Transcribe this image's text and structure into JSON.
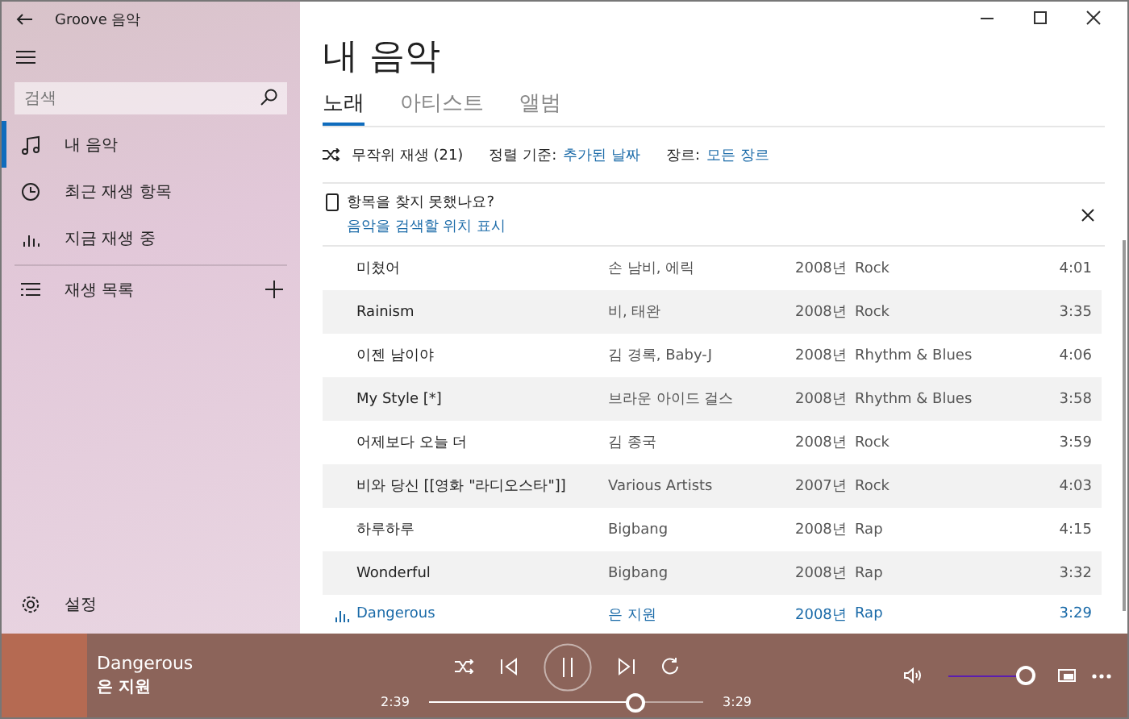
{
  "window": {
    "title": "Groove 음악"
  },
  "sidebar": {
    "search": {
      "placeholder": "검색"
    },
    "items": [
      {
        "label": "내 음악",
        "selected": true
      },
      {
        "label": "최근 재생 항목",
        "selected": false
      },
      {
        "label": "지금 재생 중",
        "selected": false
      }
    ],
    "playlists": {
      "label": "재생 목록"
    },
    "settings": {
      "label": "설정"
    }
  },
  "page": {
    "title": "내 음악",
    "tabs": [
      {
        "label": "노래",
        "selected": true
      },
      {
        "label": "아티스트",
        "selected": false
      },
      {
        "label": "앨범",
        "selected": false
      }
    ],
    "toolbar": {
      "shuffle": "무작위 재생 (21)",
      "sort_label": "정렬 기준:",
      "sort_value": "추가된 날짜",
      "genre_label": "장르:",
      "genre_value": "모든 장르"
    },
    "notice": {
      "title": "항목을 찾지 못했나요?",
      "link": "음악을 검색할 위치 표시"
    },
    "songs": [
      {
        "title": "미쳤어",
        "artist": "손 남비, 에릭",
        "year": "2008년",
        "genre": "Rock",
        "duration": "4:01",
        "playing": false
      },
      {
        "title": "Rainism",
        "artist": "비, 태완",
        "year": "2008년",
        "genre": "Rock",
        "duration": "3:35",
        "playing": false
      },
      {
        "title": "이젠 남이야",
        "artist": "김 경록, Baby-J",
        "year": "2008년",
        "genre": "Rhythm & Blues",
        "duration": "4:06",
        "playing": false
      },
      {
        "title": "My Style [*]",
        "artist": "브라운 아이드 걸스",
        "year": "2008년",
        "genre": "Rhythm & Blues",
        "duration": "3:58",
        "playing": false
      },
      {
        "title": "어제보다 오늘 더",
        "artist": "김 종국",
        "year": "2008년",
        "genre": "Rock",
        "duration": "3:59",
        "playing": false
      },
      {
        "title": "비와 당신 [[영화 \"라디오스타\"]]",
        "artist": "Various Artists",
        "year": "2007년",
        "genre": "Rock",
        "duration": "4:03",
        "playing": false
      },
      {
        "title": "하루하루",
        "artist": "Bigbang",
        "year": "2008년",
        "genre": "Rap",
        "duration": "4:15",
        "playing": false
      },
      {
        "title": "Wonderful",
        "artist": "Bigbang",
        "year": "2008년",
        "genre": "Rap",
        "duration": "3:32",
        "playing": false
      },
      {
        "title": "Dangerous",
        "artist": "은 지원",
        "year": "2008년",
        "genre": "Rap",
        "duration": "3:29",
        "playing": true
      }
    ]
  },
  "player": {
    "title": "Dangerous",
    "artist": "은 지원",
    "elapsed": "2:39",
    "total": "3:29",
    "progress": {
      "level": 0.75
    },
    "volume": {
      "level": 1
    }
  }
}
